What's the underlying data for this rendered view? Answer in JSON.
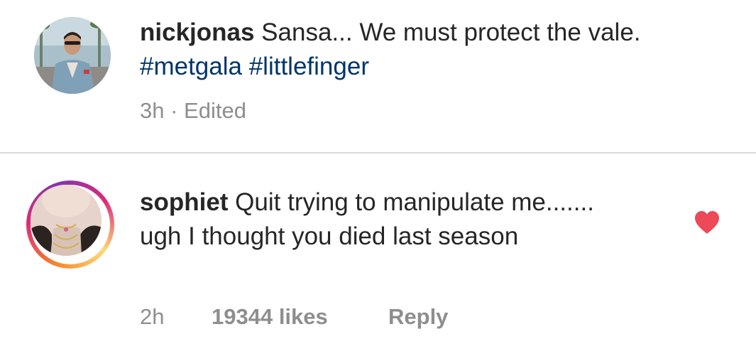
{
  "caption": {
    "username": "nickjonas",
    "text_before": " Sansa... We must protect the vale. ",
    "hashtags": [
      "#metgala",
      "#littlefinger"
    ],
    "time": "3h",
    "separator": " · ",
    "edited": "Edited"
  },
  "comment": {
    "username": "sophiet",
    "text": " Quit trying to manipulate me....... ugh I thought you died last season",
    "time": "2h",
    "likes": "19344 likes",
    "reply_label": "Reply",
    "liked": true,
    "heart_icon": "heart-filled-icon",
    "heart_color": "#ed4956"
  },
  "colors": {
    "hashtag": "#003569",
    "meta": "#8e8e8e",
    "divider": "#dbdbdb",
    "story_ring": [
      "#f58529",
      "#dd2a7b",
      "#8134af",
      "#feda77"
    ]
  }
}
